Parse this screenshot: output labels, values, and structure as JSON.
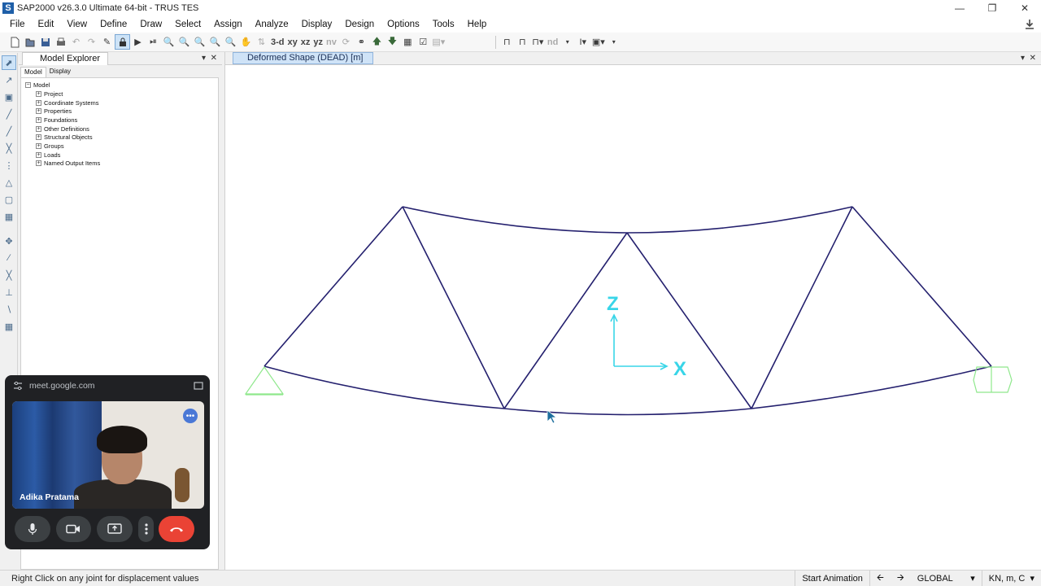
{
  "window": {
    "title": "SAP2000 v26.3.0 Ultimate 64-bit - TRUS TES",
    "logo_letter": "S",
    "minimize": "—",
    "maximize": "❐",
    "close": "✕"
  },
  "menu": [
    "File",
    "Edit",
    "View",
    "Define",
    "Draw",
    "Select",
    "Assign",
    "Analyze",
    "Display",
    "Design",
    "Options",
    "Tools",
    "Help"
  ],
  "toolbar": {
    "view_labels": [
      "3-d",
      "xy",
      "xz",
      "yz",
      "nv"
    ],
    "nd_label": "nd"
  },
  "model_explorer": {
    "title": "Model Explorer",
    "tabs": [
      "Model",
      "Display"
    ],
    "root": "Model",
    "items": [
      "Project",
      "Coordinate Systems",
      "Properties",
      "Foundations",
      "Other Definitions",
      "Structural Objects",
      "Groups",
      "Loads",
      "Named Output Items"
    ]
  },
  "viewport": {
    "tab_title": "Deformed Shape (DEAD)  [m]",
    "axis_z": "Z",
    "axis_x": "X",
    "colors": {
      "truss": "#24206e",
      "axis": "#38d5e8",
      "support": "#8fe88c"
    }
  },
  "status": {
    "message": "Right Click on any joint for displacement values",
    "start_animation": "Start Animation",
    "coord_system": "GLOBAL",
    "units": "KN, m, C"
  },
  "meet": {
    "url": "meet.google.com",
    "participant": "Adika Pratama"
  }
}
